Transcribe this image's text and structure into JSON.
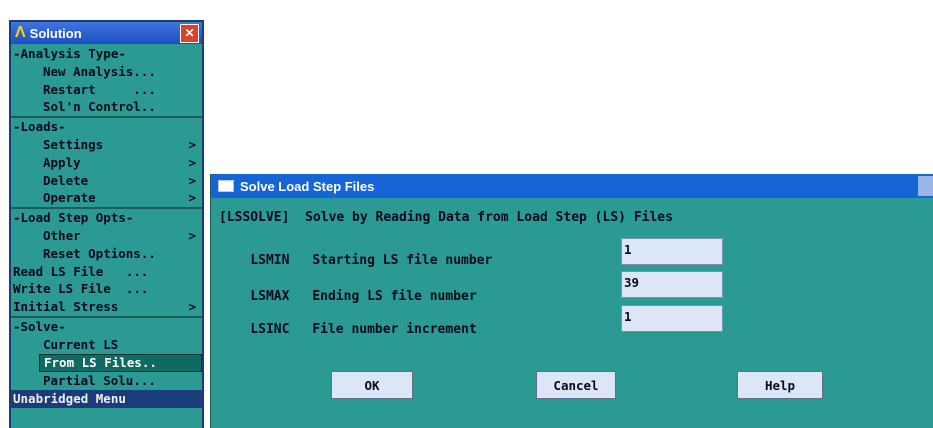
{
  "solution_panel": {
    "title": "Solution",
    "items": [
      {
        "label": "-Analysis Type-",
        "arrow": ""
      },
      {
        "label": "New Analysis...",
        "arrow": ""
      },
      {
        "label": "Restart     ...",
        "arrow": ""
      },
      {
        "label": "Sol'n Control..",
        "arrow": ""
      },
      {
        "label": "-Loads-",
        "arrow": ""
      },
      {
        "label": "Settings",
        "arrow": ">"
      },
      {
        "label": "Apply",
        "arrow": ">"
      },
      {
        "label": "Delete",
        "arrow": ">"
      },
      {
        "label": "Operate",
        "arrow": ">"
      },
      {
        "label": "-Load Step Opts-",
        "arrow": ""
      },
      {
        "label": "Other",
        "arrow": ">"
      },
      {
        "label": "Reset Options..",
        "arrow": ""
      },
      {
        "label": "Read LS File   ...",
        "arrow": ""
      },
      {
        "label": "Write LS File  ...",
        "arrow": ""
      },
      {
        "label": "Initial Stress",
        "arrow": ">"
      },
      {
        "label": "-Solve-",
        "arrow": ""
      },
      {
        "label": "Current LS",
        "arrow": ""
      },
      {
        "label": "From LS Files..",
        "arrow": ""
      },
      {
        "label": "Partial Solu...",
        "arrow": ""
      },
      {
        "label": "Unabridged Menu",
        "arrow": ""
      }
    ]
  },
  "dialog": {
    "title": "Solve Load Step Files",
    "heading": "[LSSOLVE]  Solve by Reading Data from Load Step (LS) Files",
    "fields": [
      {
        "code": "LSMIN",
        "label": "Starting LS file number",
        "value": "1"
      },
      {
        "code": "LSMAX",
        "label": "Ending LS file number",
        "value": "39"
      },
      {
        "code": "LSINC",
        "label": "File number increment",
        "value": "1"
      }
    ],
    "buttons": {
      "ok": "OK",
      "cancel": "Cancel",
      "help": "Help"
    }
  }
}
